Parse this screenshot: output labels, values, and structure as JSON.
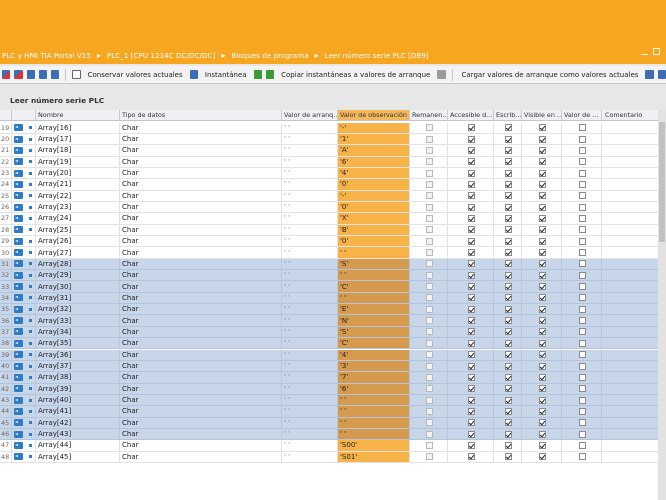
{
  "breadcrumb": [
    "PLC y HMI TIA Portal V15",
    "PLC_1 [CPU 1214C DC/DC/DC]",
    "Bloques de programa",
    "Leer número serie PLC [DB9]"
  ],
  "toolbar": {
    "keep_values": "Conservar valores actuales",
    "snapshot": "Instantánea",
    "copy_snapshots": "Copiar instantáneas a valores de arranque",
    "load_start_values": "Cargar valores de arranque como valores actuales"
  },
  "block_title": "Leer número serie PLC",
  "columns": {
    "name": "Nombre",
    "type": "Tipo de datos",
    "start": "Valor de arranq...",
    "observation": "Valor de observación",
    "retain": "Remanen...",
    "accessible": "Accesible d...",
    "writable": "Escrib...",
    "visible": "Visible en ...",
    "setpoint": "Valor de ...",
    "comment": "Comentario"
  },
  "rows": [
    {
      "num": "19",
      "name": "Array[16]",
      "type": "Char",
      "start": "' '",
      "obs": "'-'",
      "sel": false
    },
    {
      "num": "20",
      "name": "Array[17]",
      "type": "Char",
      "start": "' '",
      "obs": "'1'",
      "sel": false
    },
    {
      "num": "21",
      "name": "Array[18]",
      "type": "Char",
      "start": "' '",
      "obs": "'A'",
      "sel": false
    },
    {
      "num": "22",
      "name": "Array[19]",
      "type": "Char",
      "start": "' '",
      "obs": "'6'",
      "sel": false
    },
    {
      "num": "23",
      "name": "Array[20]",
      "type": "Char",
      "start": "' '",
      "obs": "'4'",
      "sel": false
    },
    {
      "num": "24",
      "name": "Array[21]",
      "type": "Char",
      "start": "' '",
      "obs": "'0'",
      "sel": false
    },
    {
      "num": "25",
      "name": "Array[22]",
      "type": "Char",
      "start": "' '",
      "obs": "'-'",
      "sel": false
    },
    {
      "num": "26",
      "name": "Array[23]",
      "type": "Char",
      "start": "' '",
      "obs": "'0'",
      "sel": false
    },
    {
      "num": "27",
      "name": "Array[24]",
      "type": "Char",
      "start": "' '",
      "obs": "'X'",
      "sel": false
    },
    {
      "num": "28",
      "name": "Array[25]",
      "type": "Char",
      "start": "' '",
      "obs": "'B'",
      "sel": false
    },
    {
      "num": "29",
      "name": "Array[26]",
      "type": "Char",
      "start": "' '",
      "obs": "'0'",
      "sel": false
    },
    {
      "num": "30",
      "name": "Array[27]",
      "type": "Char",
      "start": "' '",
      "obs": "' '",
      "sel": false
    },
    {
      "num": "31",
      "name": "Array[28]",
      "type": "Char",
      "start": "' '",
      "obs": "'S'",
      "sel": true
    },
    {
      "num": "32",
      "name": "Array[29]",
      "type": "Char",
      "start": "' '",
      "obs": "' '",
      "sel": true
    },
    {
      "num": "33",
      "name": "Array[30]",
      "type": "Char",
      "start": "' '",
      "obs": "'C'",
      "sel": true
    },
    {
      "num": "34",
      "name": "Array[31]",
      "type": "Char",
      "start": "' '",
      "obs": "' '",
      "sel": true
    },
    {
      "num": "35",
      "name": "Array[32]",
      "type": "Char",
      "start": "' '",
      "obs": "'E'",
      "sel": true
    },
    {
      "num": "36",
      "name": "Array[33]",
      "type": "Char",
      "start": "' '",
      "obs": "'N'",
      "sel": true
    },
    {
      "num": "37",
      "name": "Array[34]",
      "type": "Char",
      "start": "' '",
      "obs": "'S'",
      "sel": true
    },
    {
      "num": "38",
      "name": "Array[35]",
      "type": "Char",
      "start": "' '",
      "obs": "'C'",
      "sel": true
    },
    {
      "num": "39",
      "name": "Array[36]",
      "type": "Char",
      "start": "' '",
      "obs": "'4'",
      "sel": true
    },
    {
      "num": "40",
      "name": "Array[37]",
      "type": "Char",
      "start": "' '",
      "obs": "'3'",
      "sel": true
    },
    {
      "num": "41",
      "name": "Array[38]",
      "type": "Char",
      "start": "' '",
      "obs": "'7'",
      "sel": true
    },
    {
      "num": "42",
      "name": "Array[39]",
      "type": "Char",
      "start": "' '",
      "obs": "'6'",
      "sel": true
    },
    {
      "num": "43",
      "name": "Array[40]",
      "type": "Char",
      "start": "' '",
      "obs": "' '",
      "sel": true
    },
    {
      "num": "44",
      "name": "Array[41]",
      "type": "Char",
      "start": "' '",
      "obs": "' '",
      "sel": true
    },
    {
      "num": "45",
      "name": "Array[42]",
      "type": "Char",
      "start": "' '",
      "obs": "' '",
      "sel": true
    },
    {
      "num": "46",
      "name": "Array[43]",
      "type": "Char",
      "start": "' '",
      "obs": "' '",
      "sel": true
    },
    {
      "num": "47",
      "name": "Array[44]",
      "type": "Char",
      "start": "' '",
      "obs": "'S00'",
      "sel": false
    },
    {
      "num": "48",
      "name": "Array[45]",
      "type": "Char",
      "start": "' '",
      "obs": "'S01'",
      "sel": false
    }
  ],
  "colors": {
    "accent": "#f7a620",
    "observation": "#f7b347",
    "selection": "#c8d6ea"
  }
}
